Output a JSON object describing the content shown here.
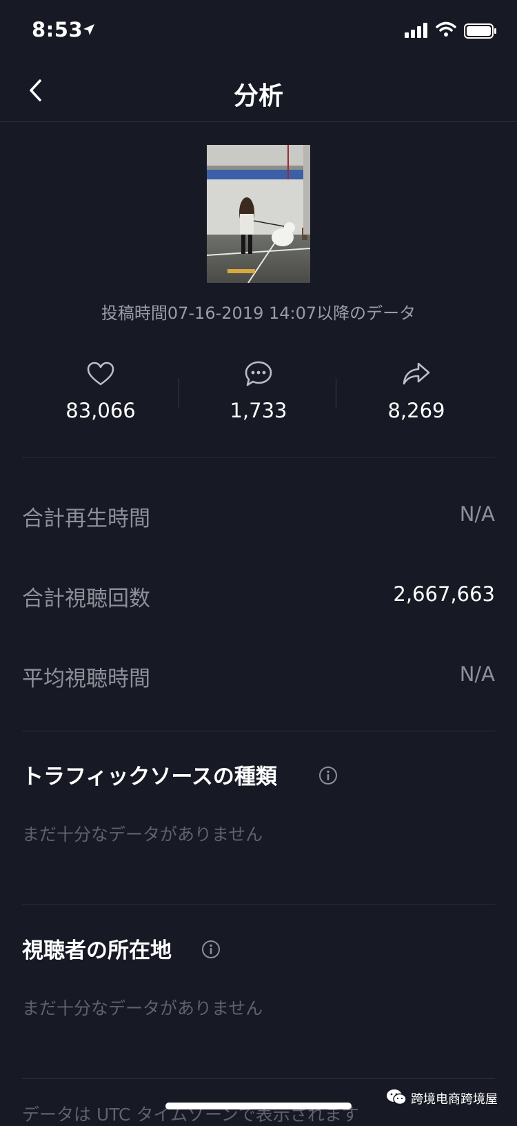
{
  "status_bar": {
    "time": "8:53",
    "icons": [
      "location-arrow-icon",
      "cellular-signal-icon",
      "wifi-icon",
      "battery-icon"
    ]
  },
  "nav": {
    "title": "分析",
    "back_icon": "chevron-left-icon"
  },
  "post": {
    "thumbnail": "video-thumbnail",
    "date_caption": "投稿時間07-16-2019 14:07以降のデータ"
  },
  "stats": {
    "likes": {
      "icon": "heart-icon",
      "value": "83,066"
    },
    "comments": {
      "icon": "comment-bubble-icon",
      "value": "1,733"
    },
    "shares": {
      "icon": "share-arrow-icon",
      "value": "8,269"
    }
  },
  "metrics": [
    {
      "label": "合計再生時間",
      "value": "N/A",
      "value_color": "#8e9099"
    },
    {
      "label": "合計視聴回数",
      "value": "2,667,663",
      "value_color": "#ffffff"
    },
    {
      "label": "平均視聴時間",
      "value": "N/A",
      "value_color": "#8e9099"
    }
  ],
  "sections": {
    "traffic": {
      "title": "トラフィックソースの種類",
      "empty": "まだ十分なデータがありません",
      "icon": "info-icon"
    },
    "audience": {
      "title": "視聴者の所在地",
      "empty": "まだ十分なデータがありません",
      "icon": "info-icon"
    }
  },
  "footer": {
    "note": "データは UTC タイムゾーンで表示されます"
  },
  "watermark": {
    "text": "跨境电商跨境屋",
    "icon": "wechat-icon"
  },
  "colors": {
    "background": "#171a24",
    "divider": "#2c303b",
    "muted_text": "#8e9099",
    "faint_text": "#5f616b"
  }
}
